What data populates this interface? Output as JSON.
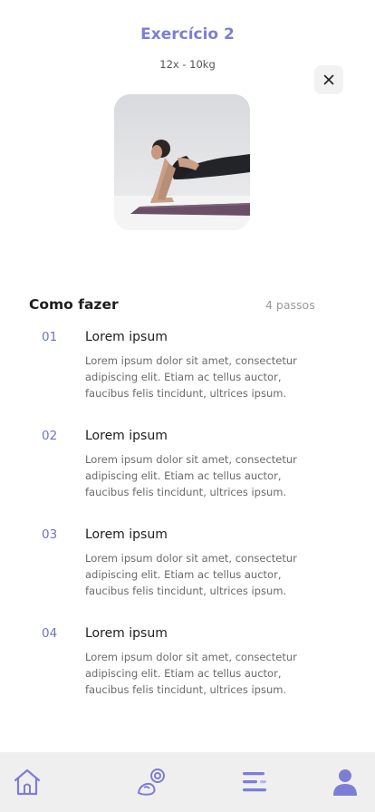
{
  "header": {
    "title": "Exercício  2",
    "subtitle": "12x - 10kg"
  },
  "colors": {
    "accent": "#7b7fd4",
    "tabbar_bg": "#f0efef"
  },
  "section": {
    "title": "Como fazer",
    "count": "4 passos"
  },
  "steps": [
    {
      "number": "01",
      "title": "Lorem ipsum",
      "description": "Lorem ipsum dolor sit amet, consectetur adipiscing elit. Etiam ac tellus auctor, faucibus felis tincidunt, ultrices ipsum."
    },
    {
      "number": "02",
      "title": "Lorem ipsum",
      "description": "Lorem ipsum dolor sit amet, consectetur adipiscing elit. Etiam ac tellus auctor, faucibus felis tincidunt, ultrices ipsum."
    },
    {
      "number": "03",
      "title": "Lorem ipsum",
      "description": "Lorem ipsum dolor sit amet, consectetur adipiscing elit. Etiam ac tellus auctor, faucibus felis tincidunt, ultrices ipsum."
    },
    {
      "number": "04",
      "title": "Lorem ipsum",
      "description": "Lorem ipsum dolor sit amet, consectetur adipiscing elit. Etiam ac tellus auctor, faucibus felis tincidunt, ultrices ipsum."
    }
  ],
  "tabbar": {
    "items": [
      {
        "icon": "home-icon"
      },
      {
        "icon": "fitness-icon"
      },
      {
        "icon": "menu-icon"
      },
      {
        "icon": "user-icon"
      }
    ]
  }
}
